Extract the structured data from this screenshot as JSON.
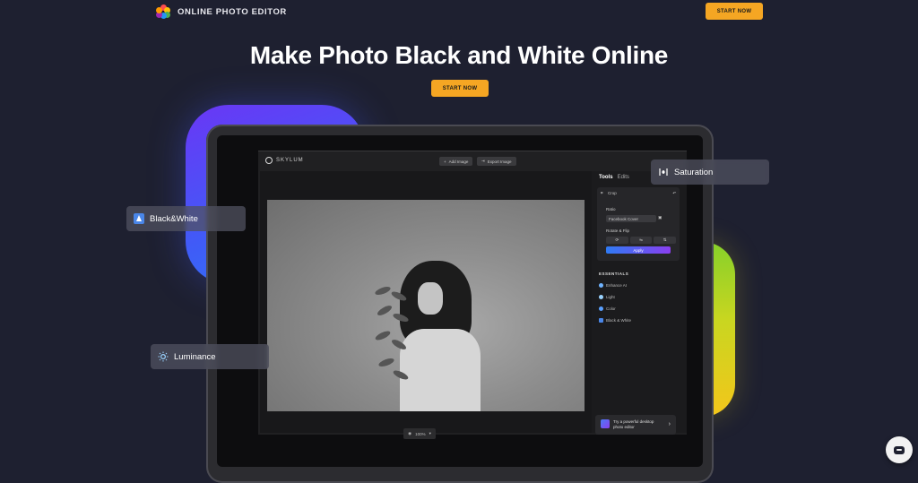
{
  "header": {
    "logo_text": "ONLINE PHOTO EDITOR",
    "cta_label": "START NOW"
  },
  "hero": {
    "title": "Make Photo Black and White Online",
    "cta_label": "START NOW"
  },
  "chips": {
    "black_white": "Black&White",
    "saturation": "Saturation",
    "luminance": "Luminance"
  },
  "app": {
    "brand": "SKYLUM",
    "add_image": "Add Image",
    "export_image": "Export Image",
    "zoom": "100%",
    "tabs": [
      "Tools",
      "Edits"
    ],
    "crop_panel": {
      "title": "Crop",
      "ratio_label": "Ratio",
      "ratio_value": "Facebook Cover",
      "rotate_label": "Rotate & Flip",
      "apply_label": "Apply"
    },
    "essentials": {
      "title": "ESSENTIALS",
      "items": [
        "Enhance AI",
        "Light",
        "Color",
        "Black & White"
      ]
    },
    "promo": {
      "text": "Try a powerful desktop photo editor"
    }
  },
  "colors": {
    "accent": "#f5a623",
    "background": "#1e2030",
    "purple_panel": "#5a45f5",
    "yellow_panel": "#e8cf1c"
  },
  "icons": {
    "chat": "chat-bubble-icon",
    "saturation": "saturation-slider-icon",
    "luminance": "sun-icon",
    "black_white": "bw-triangle-icon"
  }
}
